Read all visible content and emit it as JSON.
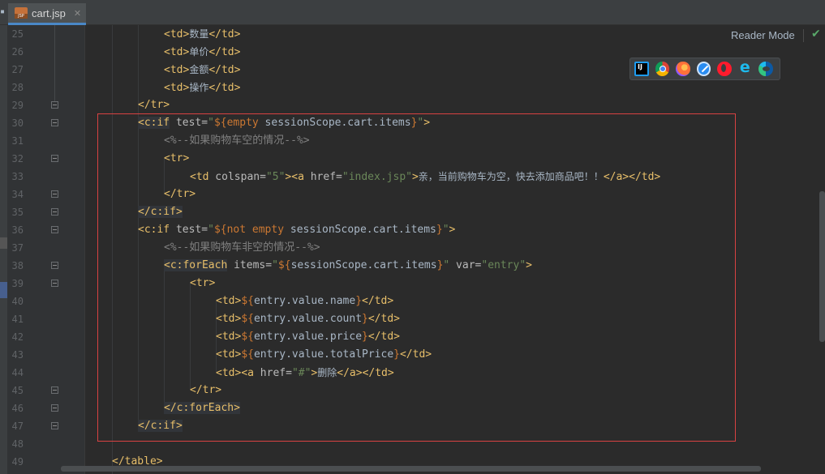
{
  "tab": {
    "icon_label": "JSP",
    "title": "cart.jsp",
    "close": "✕"
  },
  "toolbar": {
    "reader_mode": "Reader Mode",
    "check": "✔"
  },
  "browsers": [
    "intellij-icon",
    "chrome-icon",
    "firefox-icon",
    "safari-icon",
    "opera-icon",
    "ie-icon",
    "edge-icon"
  ],
  "line_numbers": [
    "25",
    "26",
    "27",
    "28",
    "29",
    "30",
    "31",
    "32",
    "33",
    "34",
    "35",
    "36",
    "37",
    "38",
    "39",
    "40",
    "41",
    "42",
    "43",
    "44",
    "45",
    "46",
    "47",
    "48",
    "49"
  ],
  "code": {
    "l25": {
      "open": "<td>",
      "text": "数量",
      "close": "</td>"
    },
    "l26": {
      "open": "<td>",
      "text": "单价",
      "close": "</td>"
    },
    "l27": {
      "open": "<td>",
      "text": "金额",
      "close": "</td>"
    },
    "l28": {
      "open": "<td>",
      "text": "操作",
      "close": "</td>"
    },
    "l29": {
      "tag": "</tr>"
    },
    "l30": {
      "tag_open": "<c:if",
      "attr": " test=",
      "q1": "\"",
      "el_open": "${",
      "kw": "empty",
      "expr": " sessionScope.cart.items",
      "el_close": "}",
      "q2": "\"",
      "tag_close": ">"
    },
    "l31": {
      "comment": "<%--如果购物车空的情况--%>"
    },
    "l32": {
      "tag": "<tr>"
    },
    "l33": {
      "tag_open": "<td",
      "attr1": " colspan=",
      "val1": "\"5\"",
      "gt1": ">",
      "a_open": "<a",
      "attr2": " href=",
      "val2": "\"index.jsp\"",
      "gt2": ">",
      "text": "亲，当前购物车为空，快去添加商品吧！！",
      "close": "</a></td>"
    },
    "l34": {
      "tag": "</tr>"
    },
    "l35": {
      "tag": "</c:if>"
    },
    "l36": {
      "tag_open": "<c:if",
      "attr": " test=",
      "q1": "\"",
      "el_open": "${",
      "kw": "not empty",
      "expr": " sessionScope.cart.items",
      "el_close": "}",
      "q2": "\"",
      "tag_close": ">"
    },
    "l37": {
      "comment": "<%--如果购物车非空的情况--%>"
    },
    "l38": {
      "tag_open": "<c:forEach",
      "attr1": " items=",
      "q1": "\"",
      "el_open": "${",
      "expr": "sessionScope.cart.items",
      "el_close": "}",
      "q2": "\"",
      "attr2": " var=",
      "val2": "\"entry\"",
      "tag_close": ">"
    },
    "l39": {
      "tag": "<tr>"
    },
    "l40": {
      "open": "<td>",
      "el_open": "${",
      "expr": "entry.value.name",
      "el_close": "}",
      "close": "</td>"
    },
    "l41": {
      "open": "<td>",
      "el_open": "${",
      "expr": "entry.value.count",
      "el_close": "}",
      "close": "</td>"
    },
    "l42": {
      "open": "<td>",
      "el_open": "${",
      "expr": "entry.value.price",
      "el_close": "}",
      "close": "</td>"
    },
    "l43": {
      "open": "<td>",
      "el_open": "${",
      "expr": "entry.value.totalPrice",
      "el_close": "}",
      "close": "</td>"
    },
    "l44": {
      "open": "<td>",
      "a_open": "<a",
      "attr": " href=",
      "val": "\"#\"",
      "gt": ">",
      "text": "删除",
      "close": "</a></td>"
    },
    "l45": {
      "tag": "</tr>"
    },
    "l46": {
      "tag": "</c:forEach>"
    },
    "l47": {
      "tag": "</c:if>"
    },
    "l49": {
      "tag": "</table>"
    }
  }
}
